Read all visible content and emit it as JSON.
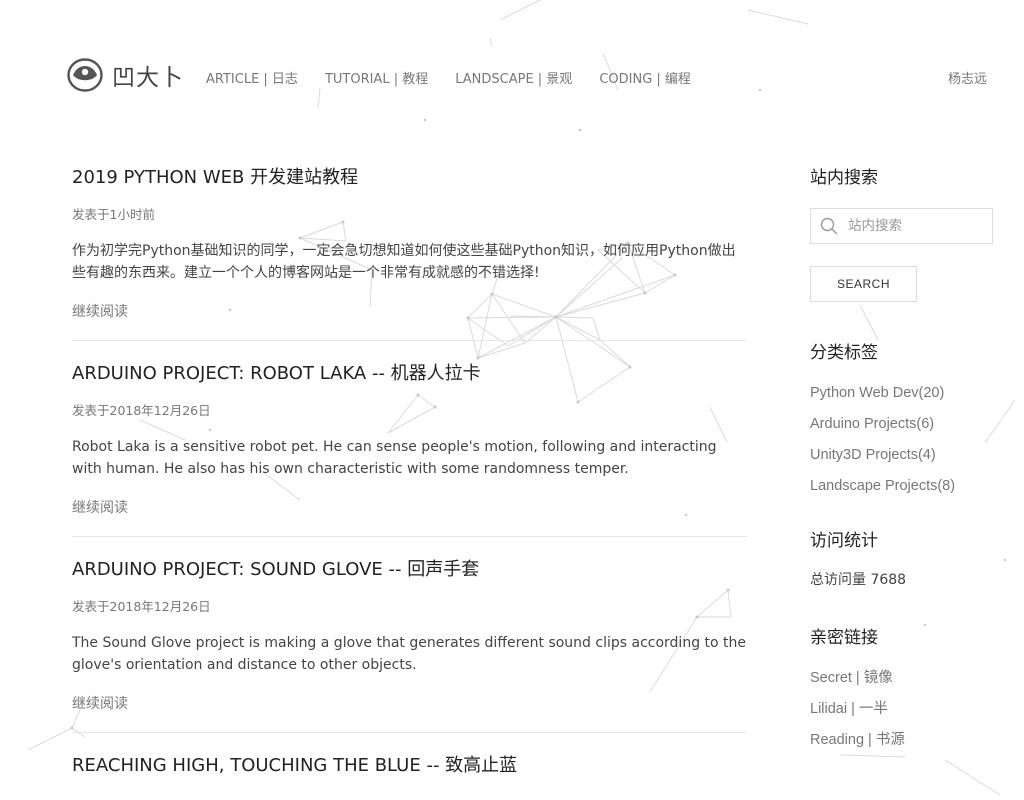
{
  "site": {
    "logo_text": "凹大卜",
    "nav": [
      {
        "label": "ARTICLE | 日志"
      },
      {
        "label": "TUTORIAL | 教程"
      },
      {
        "label": "LANDSCAPE | 景观"
      },
      {
        "label": "CODING | 编程"
      }
    ],
    "user": "杨志远"
  },
  "articles": [
    {
      "title": "2019 PYTHON WEB 开发建站教程",
      "date": "发表于1小时前",
      "summary": "作为初学完Python基础知识的同学，一定会急切想知道如何使这些基础Python知识，如何应用Python做出些有趣的东西来。建立一个个人的博客网站是一个非常有成就感的不错选择!",
      "read_more": "继续阅读"
    },
    {
      "title": "ARDUINO PROJECT: ROBOT LAKA -- 机器人拉卡",
      "date": "发表于2018年12月26日",
      "summary": "Robot Laka is a sensitive robot pet. He can sense people's motion, following and interacting with human. He also has his own characteristic with some randomness temper.",
      "read_more": "继续阅读"
    },
    {
      "title": "ARDUINO PROJECT: SOUND GLOVE -- 回声手套",
      "date": "发表于2018年12月26日",
      "summary": "The Sound Glove project is making a glove that generates different sound clips according to the glove's orientation and distance to other objects.",
      "read_more": "继续阅读"
    },
    {
      "title": "REACHING HIGH, TOUCHING THE BLUE -- 致高止蓝"
    }
  ],
  "sidebar": {
    "search": {
      "heading": "站内搜索",
      "placeholder": "站内搜索",
      "button": "SEARCH"
    },
    "categories": {
      "heading": "分类标签",
      "items": [
        "Python Web Dev(20)",
        "Arduino Projects(6)",
        "Unity3D Projects(4)",
        "Landscape Projects(8)"
      ]
    },
    "stats": {
      "heading": "访问统计",
      "total": "总访问量 7688"
    },
    "links": {
      "heading": "亲密链接",
      "items": [
        "Secret | 镜像",
        "Lilidai | 一半",
        "Reading | 书源"
      ]
    }
  },
  "colors": {
    "background": "#ffffff",
    "text_dark": "#222222",
    "text_muted": "#777777",
    "divider": "#e6e6e6",
    "network_lines": "#cccccc"
  },
  "icons": {
    "logo": "eye-icon",
    "search": "search-icon"
  }
}
